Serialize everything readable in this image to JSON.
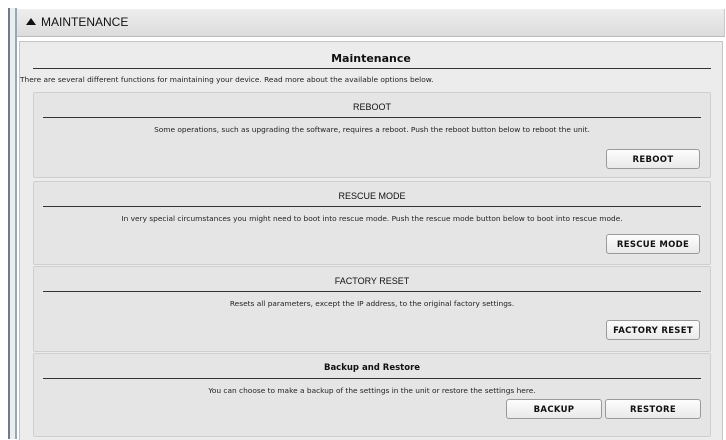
{
  "header": {
    "collapse_icon": "triangle-up-icon",
    "title": "MAINTENANCE"
  },
  "panel": {
    "title": "Maintenance",
    "intro": "There are several different functions for maintaining your device. Read more about the available options below."
  },
  "sections": {
    "reboot": {
      "title": "REBOOT",
      "description": "Some operations, such as upgrading the software, requires a reboot. Push the reboot button below to reboot the unit.",
      "button": "REBOOT"
    },
    "rescue": {
      "title": "RESCUE MODE",
      "description": "In very special circumstances you might need to boot into rescue mode. Push the rescue mode button below to boot into rescue mode.",
      "button": "RESCUE MODE"
    },
    "factory": {
      "title": "FACTORY RESET",
      "description": "Resets all parameters, except the IP address, to the original factory settings.",
      "button": "FACTORY RESET"
    },
    "backup": {
      "title": "Backup and Restore",
      "description": "You can choose to make a backup of the settings in the unit or restore the settings here.",
      "backup_button": "BACKUP",
      "restore_button": "RESTORE"
    }
  }
}
